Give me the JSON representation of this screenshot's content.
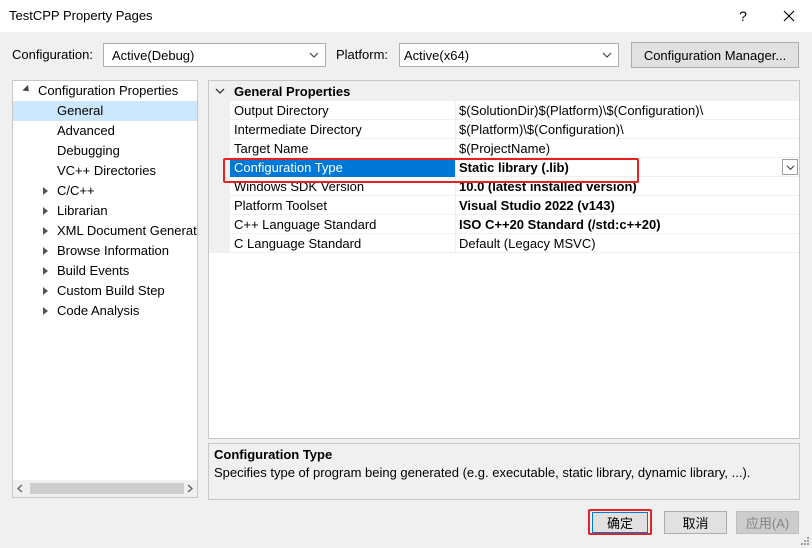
{
  "window": {
    "title": "TestCPP Property Pages",
    "help_label": "?"
  },
  "toolbar": {
    "configuration_label": "Configuration:",
    "configuration_value": "Active(Debug)",
    "platform_label": "Platform:",
    "platform_value": "Active(x64)",
    "config_manager_label": "Configuration Manager..."
  },
  "tree": {
    "root_label": "Configuration Properties",
    "items": [
      {
        "label": "General",
        "selected": true
      },
      {
        "label": "Advanced"
      },
      {
        "label": "Debugging"
      },
      {
        "label": "VC++ Directories"
      },
      {
        "label": "C/C++"
      },
      {
        "label": "Librarian"
      },
      {
        "label": "XML Document Generat"
      },
      {
        "label": "Browse Information"
      },
      {
        "label": "Build Events"
      },
      {
        "label": "Custom Build Step"
      },
      {
        "label": "Code Analysis"
      }
    ]
  },
  "grid": {
    "category": "General Properties",
    "rows": [
      {
        "name": "Output Directory",
        "value": "$(SolutionDir)$(Platform)\\$(Configuration)\\"
      },
      {
        "name": "Intermediate Directory",
        "value": "$(Platform)\\$(Configuration)\\"
      },
      {
        "name": "Target Name",
        "value": "$(ProjectName)"
      },
      {
        "name": "Configuration Type",
        "value": "Static library (.lib)"
      },
      {
        "name": "Windows SDK Version",
        "value": "10.0 (latest installed version)"
      },
      {
        "name": "Platform Toolset",
        "value": "Visual Studio 2022 (v143)"
      },
      {
        "name": "C++ Language Standard",
        "value": "ISO C++20 Standard (/std:c++20)"
      },
      {
        "name": "C Language Standard",
        "value": "Default (Legacy MSVC)"
      }
    ]
  },
  "description": {
    "title": "Configuration Type",
    "text": "Specifies type of program being generated (e.g. executable, static library, dynamic library, ...)."
  },
  "buttons": {
    "ok": "确定",
    "cancel": "取消",
    "apply": "应用(A)"
  },
  "colors": {
    "selection": "#0078d7",
    "tree_selection": "#cce8ff",
    "highlight": "#e52222"
  }
}
